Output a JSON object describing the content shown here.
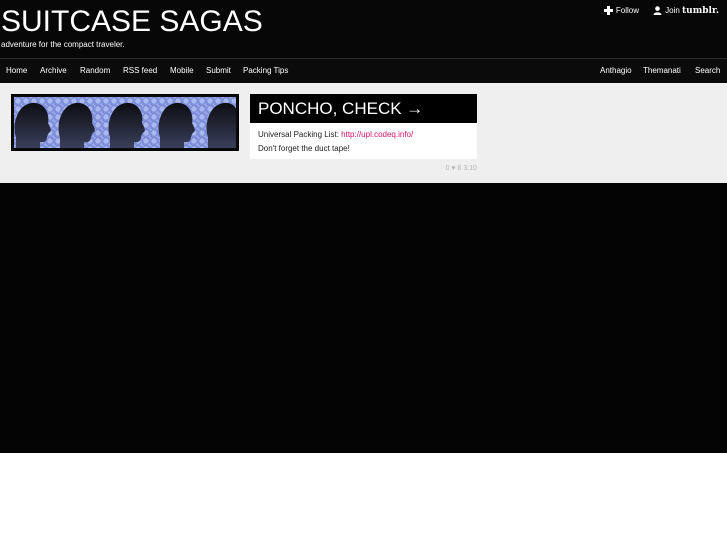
{
  "blog": {
    "title": "SUITCASE SAGAS",
    "tagline": "adventure for the compact traveler."
  },
  "tumblr_controls": {
    "follow_label": "Follow",
    "join_label": "Join",
    "brand": "tumblr."
  },
  "nav": {
    "left": [
      "Home",
      "Archive",
      "Random",
      "RSS feed",
      "Mobile",
      "Submit",
      "Packing Tips"
    ],
    "right": [
      "Anthagio",
      "Themanati",
      "Search"
    ]
  },
  "post": {
    "title": "PONCHO, CHECK →",
    "line1_text": "Universal Packing List: ",
    "line1_link": "http://upl.codeq.info/",
    "line2_text": "Don't forget the duct tape!",
    "meta_count": "0",
    "meta_heart": "♥",
    "meta_time": "8 3:10"
  },
  "colors": {
    "header_bg": "#070707",
    "content_bg": "#efefef",
    "link_accent": "#d4116b",
    "banner_pattern": "#7f8fd9"
  },
  "icons": {
    "follow": "plus-icon",
    "join": "user-icon",
    "heart": "heart-icon"
  }
}
